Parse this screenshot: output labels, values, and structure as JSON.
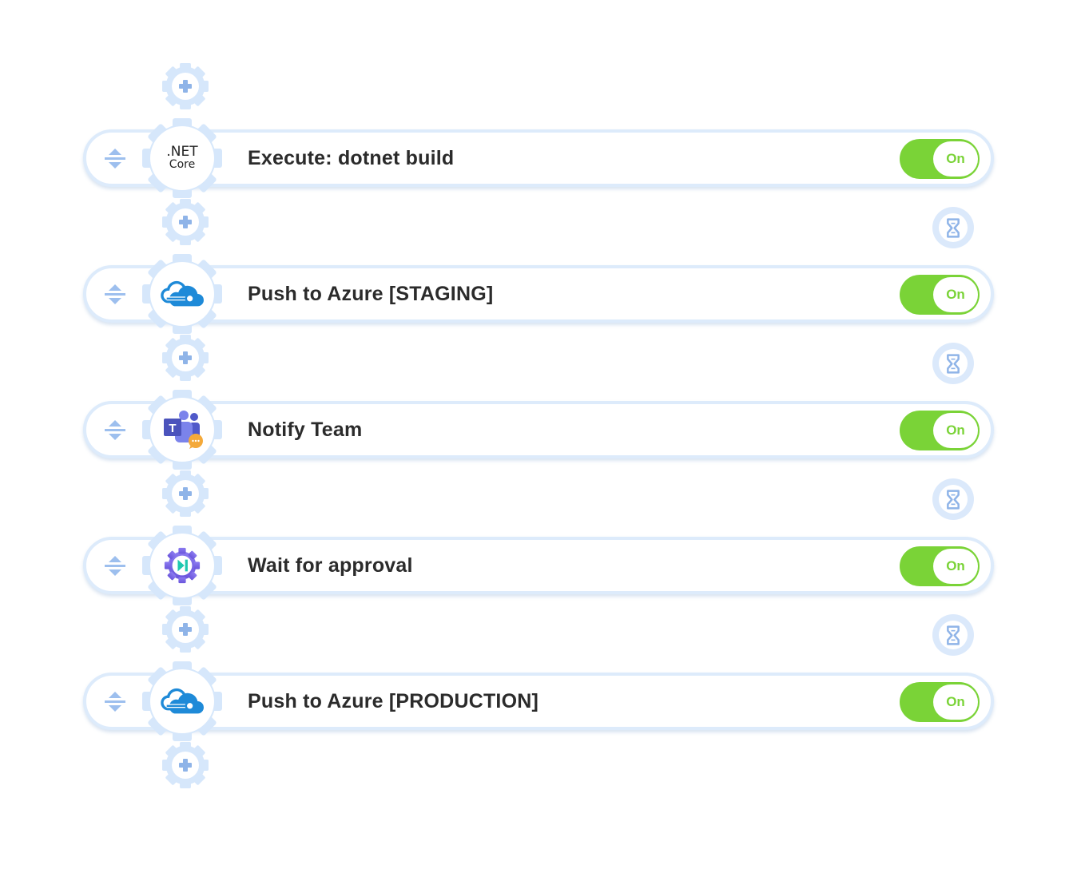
{
  "colors": {
    "accent_light": "#d6e7fb",
    "toggle_on": "#7ad337",
    "icon_blue": "#8fb4e8",
    "title_text": "#2b2b2b"
  },
  "steps": [
    {
      "title": "Execute: dotnet build",
      "icon": "dotnet-core-icon",
      "logo_line1": ".NET",
      "logo_line2": "Core",
      "toggle": "On",
      "enabled": true
    },
    {
      "title": "Push to Azure [STAGING]",
      "icon": "azure-cloud-icon",
      "toggle": "On",
      "enabled": true
    },
    {
      "title": "Notify Team",
      "icon": "microsoft-teams-icon",
      "toggle": "On",
      "enabled": true
    },
    {
      "title": "Wait for approval",
      "icon": "approval-gear-icon",
      "toggle": "On",
      "enabled": true
    },
    {
      "title": "Push to Azure [PRODUCTION]",
      "icon": "azure-cloud-icon",
      "toggle": "On",
      "enabled": true
    }
  ],
  "connectors": {
    "add_icon": "plus-icon",
    "delay_icon": "hourglass-icon"
  }
}
